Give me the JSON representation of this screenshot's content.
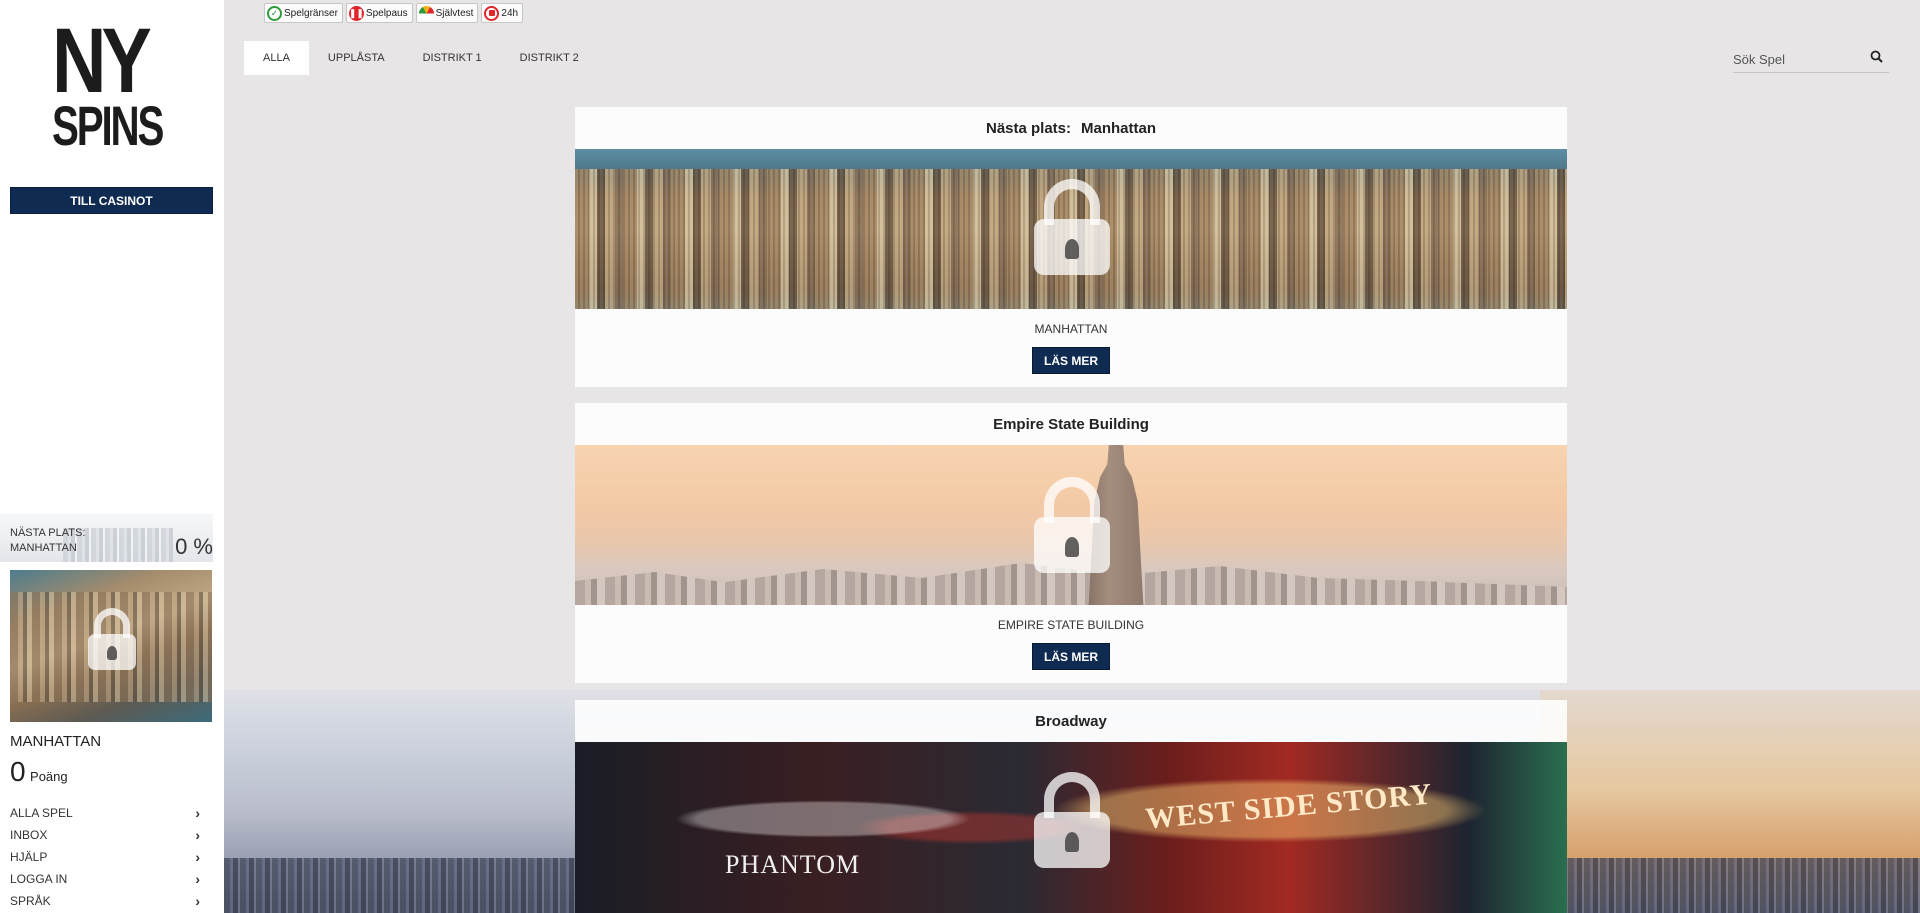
{
  "sidebar": {
    "logo_top": "NY",
    "logo_bottom": "SPINS",
    "casino_button": "TILL CASINOT",
    "next_place_label": "NÄSTA PLATS:",
    "next_place_name": "MANHATTAN",
    "progress_text": "0 %",
    "progress_value": 0,
    "current_title": "MANHATTAN",
    "points_value": "0",
    "points_label": "Poäng",
    "menu": [
      {
        "label": "ALLA SPEL"
      },
      {
        "label": "INBOX"
      },
      {
        "label": "HJÄLP"
      },
      {
        "label": "LOGGA IN"
      },
      {
        "label": "SPRÅK"
      }
    ]
  },
  "rg_bar": [
    {
      "label": "Spelgränser",
      "icon": "limits-icon",
      "color": "#2e9b3a"
    },
    {
      "label": "Spelpaus",
      "icon": "pause-icon",
      "color": "#e0262b"
    },
    {
      "label": "Självtest",
      "icon": "gauge-icon",
      "color": "#f2b21b"
    },
    {
      "label": "24h",
      "icon": "stop-icon",
      "color": "#e0262b"
    }
  ],
  "tabs": [
    {
      "label": "ALLA",
      "active": true
    },
    {
      "label": "UPPLÅSTA"
    },
    {
      "label": "DISTRIKT 1"
    },
    {
      "label": "DISTRIKT 2"
    }
  ],
  "search": {
    "placeholder": "Sök Spel"
  },
  "cards": [
    {
      "header_prefix": "Nästa plats:",
      "header": "Manhattan",
      "caption": "MANHATTAN",
      "button": "LÄS MER"
    },
    {
      "header": "Empire State Building",
      "caption": "EMPIRE STATE BUILDING",
      "button": "LÄS MER"
    },
    {
      "header": "Broadway",
      "sign_1": "PHANTOM",
      "sign_2": "WEST SIDE STORY"
    }
  ],
  "colors": {
    "brand_navy": "#0f2b52",
    "page_bg": "#e8e5e7"
  }
}
